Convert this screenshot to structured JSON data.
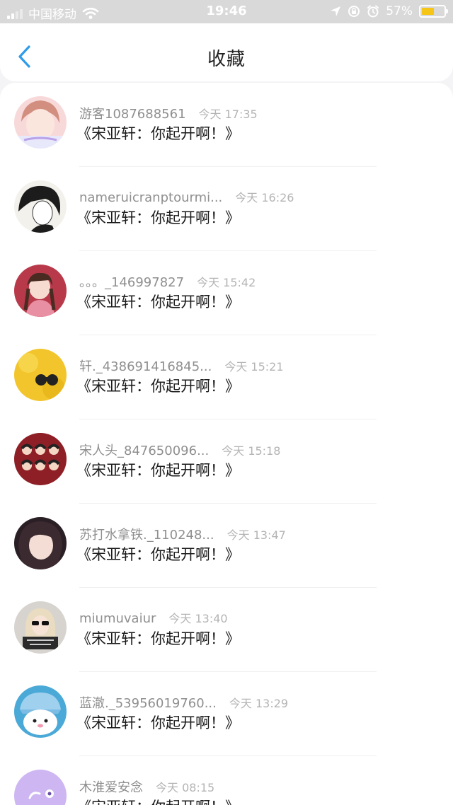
{
  "status_bar": {
    "carrier": "中国移动",
    "time": "19:46",
    "battery_text": "57%",
    "battery_level": 0.57,
    "battery_color": "#f5c518"
  },
  "nav": {
    "back_icon": "chevron-left-icon",
    "title": "收藏",
    "accent_color": "#2f9bea"
  },
  "items": [
    {
      "username": "游客1087688561",
      "time": "今天 17:35",
      "message": "《宋亚轩：你起开啊！》"
    },
    {
      "username": "nameruicranptourmi...",
      "time": "今天 16:26",
      "message": "《宋亚轩：你起开啊！》"
    },
    {
      "username": "。。。_146997827",
      "time": "今天 15:42",
      "message": "《宋亚轩：你起开啊！》"
    },
    {
      "username": "轩._438691416845...",
      "time": "今天 15:21",
      "message": "《宋亚轩：你起开啊！》"
    },
    {
      "username": "宋人头_847650096...",
      "time": "今天 15:18",
      "message": "《宋亚轩：你起开啊！》"
    },
    {
      "username": "苏打水拿铁._110248...",
      "time": "今天 13:47",
      "message": "《宋亚轩：你起开啊！》"
    },
    {
      "username": "miumuvaiur",
      "time": "今天 13:40",
      "message": "《宋亚轩：你起开啊！》"
    },
    {
      "username": "蓝澈._53956019760...",
      "time": "今天 13:29",
      "message": "《宋亚轩：你起开啊！》"
    },
    {
      "username": "木淮爱安念",
      "time": "今天 08:15",
      "message": "《宋亚轩：你起开啊！》"
    }
  ]
}
